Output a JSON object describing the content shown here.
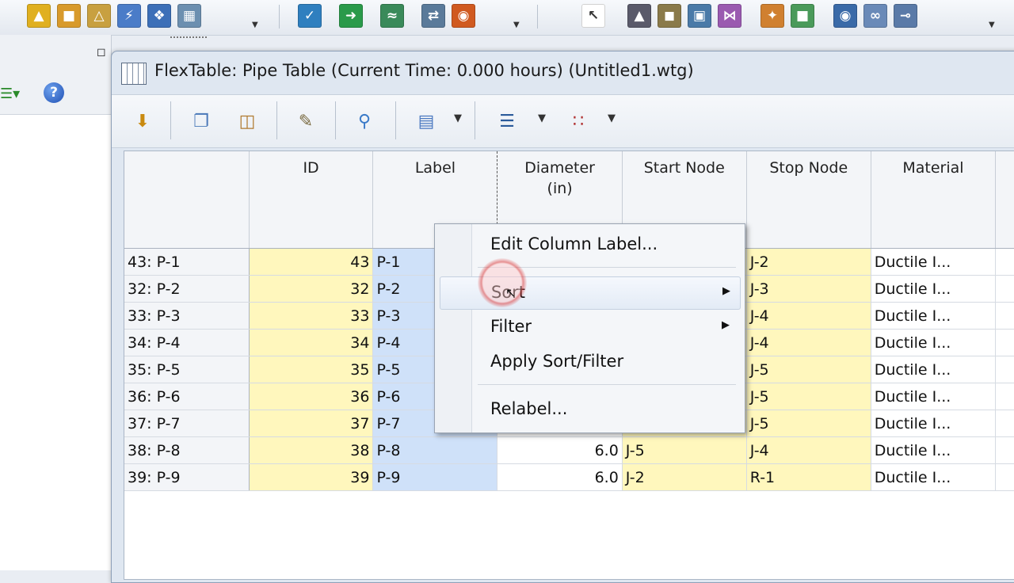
{
  "main_toolbar": {
    "icons_group1": [
      "hydrant-flow-icon",
      "scenario-manager-icon",
      "skelebrator-icon",
      "criticality-icon",
      "network-navigator-icon",
      "property-grid-icon"
    ],
    "icons_group2": [
      "validate-icon",
      "compute-icon",
      "graph-icon",
      "transfer-icon",
      "report-icon"
    ],
    "icons_group3": [
      "select-pointer-icon",
      "pump-tool-icon",
      "tank-tool-icon",
      "reservoir-tool-icon",
      "valve-tool-icon",
      "junction-tool-icon",
      "map-tool-icon",
      "globe-tool-icon",
      "pipe-tool-icon",
      "lateral-tool-icon"
    ]
  },
  "window": {
    "title": "FlexTable: Pipe Table (Current Time:  0.000 hours) (Untitled1.wtg)"
  },
  "flextable_toolbar": {
    "buttons": [
      "export-icon",
      "copy-icon",
      "paste-icon",
      "edit-icon",
      "zoom-icon",
      "report-icon",
      "columns-icon",
      "select-icon"
    ]
  },
  "table": {
    "columns": [
      {
        "label": ""
      },
      {
        "label": "ID"
      },
      {
        "label": "Label"
      },
      {
        "label": "Diameter"
      },
      {
        "label": "Start Node"
      },
      {
        "label": "Stop Node"
      },
      {
        "label": "Material"
      }
    ],
    "diameter_unit": "(in)",
    "rows": [
      {
        "row": "43: P-1",
        "id": "43",
        "label": "P-1",
        "diameter": "",
        "start": "",
        "stop": "J-2",
        "material": "Ductile I..."
      },
      {
        "row": "32: P-2",
        "id": "32",
        "label": "P-2",
        "diameter": "",
        "start": "",
        "stop": "J-3",
        "material": "Ductile I..."
      },
      {
        "row": "33: P-3",
        "id": "33",
        "label": "P-3",
        "diameter": "",
        "start": "",
        "stop": "J-4",
        "material": "Ductile I..."
      },
      {
        "row": "34: P-4",
        "id": "34",
        "label": "P-4",
        "diameter": "",
        "start": "",
        "stop": "J-4",
        "material": "Ductile I..."
      },
      {
        "row": "35: P-5",
        "id": "35",
        "label": "P-5",
        "diameter": "",
        "start": "",
        "stop": "J-5",
        "material": "Ductile I..."
      },
      {
        "row": "36: P-6",
        "id": "36",
        "label": "P-6",
        "diameter": "",
        "start": "",
        "stop": "J-5",
        "material": "Ductile I..."
      },
      {
        "row": "37: P-7",
        "id": "37",
        "label": "P-7",
        "diameter": "",
        "start": "",
        "stop": "J-5",
        "material": "Ductile I..."
      },
      {
        "row": "38: P-8",
        "id": "38",
        "label": "P-8",
        "diameter": "6.0",
        "start": "J-5",
        "stop": "J-4",
        "material": "Ductile I..."
      },
      {
        "row": "39: P-9",
        "id": "39",
        "label": "P-9",
        "diameter": "6.0",
        "start": "J-2",
        "stop": "R-1",
        "material": "Ductile I..."
      }
    ]
  },
  "context_menu": {
    "items": [
      {
        "label": "Edit Column Label..."
      },
      {
        "label": "Sort"
      },
      {
        "label": "Filter"
      },
      {
        "label": "Apply Sort/Filter"
      },
      {
        "label": "Relabel..."
      }
    ]
  },
  "colors": {
    "yellow_cell": "#fff7bd",
    "blue_cell": "#cfe1f9"
  }
}
